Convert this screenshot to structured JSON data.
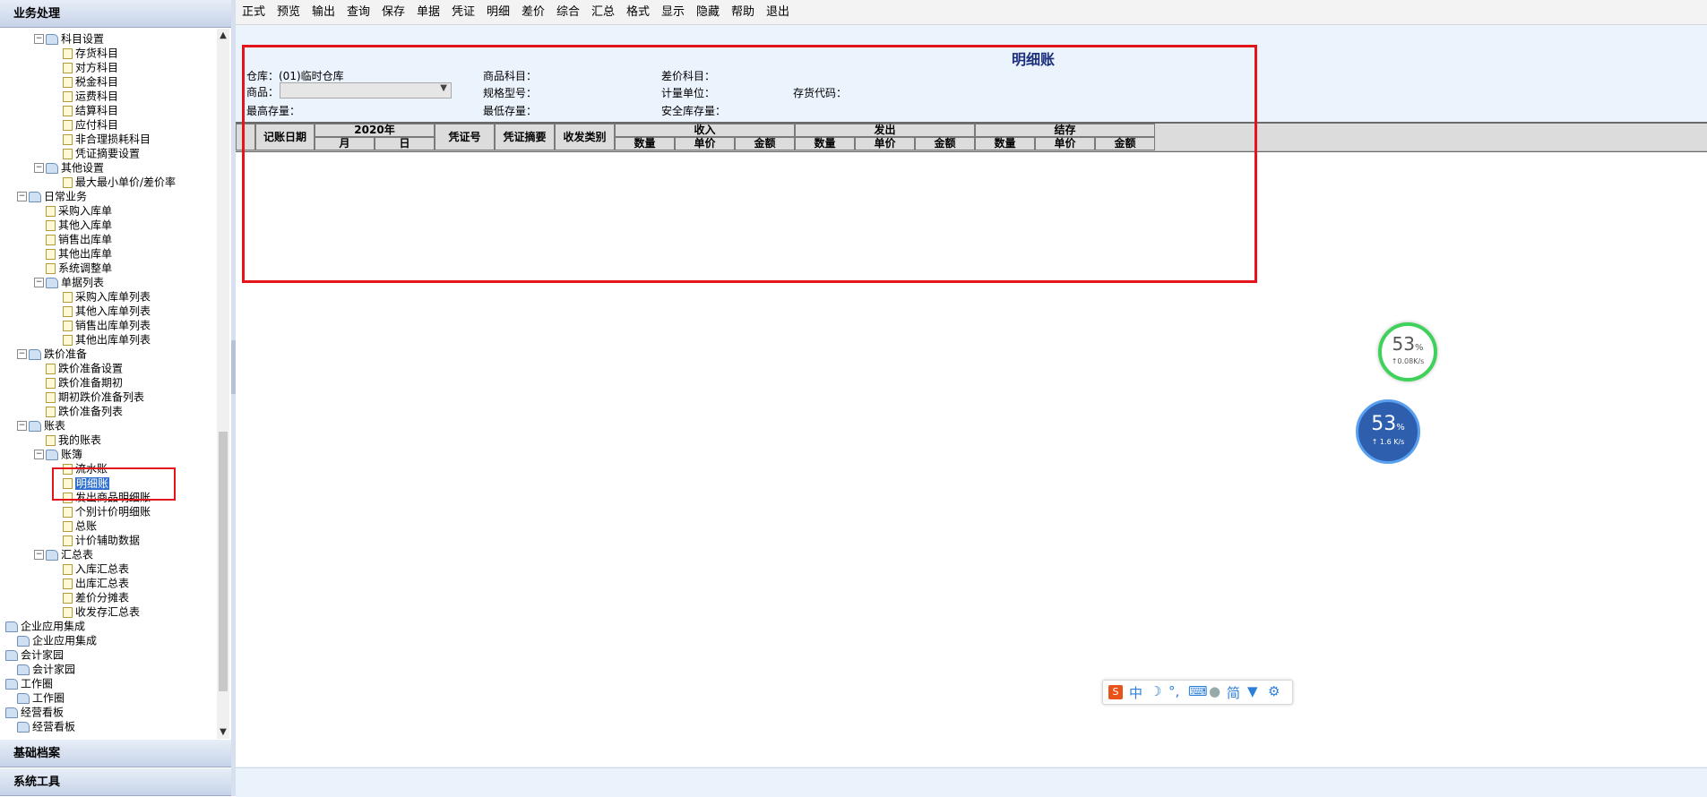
{
  "left_panel": {
    "header": "业务处理",
    "footer_items": [
      "基础档案",
      "系统工具"
    ],
    "tree": [
      {
        "label": "科目设置",
        "type": "folder",
        "level": 2,
        "toggle": "−"
      },
      {
        "label": "存货科目",
        "type": "doc",
        "level": 3
      },
      {
        "label": "对方科目",
        "type": "doc",
        "level": 3
      },
      {
        "label": "税金科目",
        "type": "doc",
        "level": 3
      },
      {
        "label": "运费科目",
        "type": "doc",
        "level": 3
      },
      {
        "label": "结算科目",
        "type": "doc",
        "level": 3
      },
      {
        "label": "应付科目",
        "type": "doc",
        "level": 3
      },
      {
        "label": "非合理损耗科目",
        "type": "doc",
        "level": 3
      },
      {
        "label": "凭证摘要设置",
        "type": "doc",
        "level": 3
      },
      {
        "label": "其他设置",
        "type": "folder",
        "level": 2,
        "toggle": "−"
      },
      {
        "label": "最大最小单价/差价率",
        "type": "doc",
        "level": 3
      },
      {
        "label": "日常业务",
        "type": "folder",
        "level": 1,
        "toggle": "−"
      },
      {
        "label": "采购入库单",
        "type": "doc",
        "level": 2
      },
      {
        "label": "其他入库单",
        "type": "doc",
        "level": 2
      },
      {
        "label": "销售出库单",
        "type": "doc",
        "level": 2
      },
      {
        "label": "其他出库单",
        "type": "doc",
        "level": 2
      },
      {
        "label": "系统调整单",
        "type": "doc",
        "level": 2
      },
      {
        "label": "单据列表",
        "type": "folder",
        "level": 2,
        "toggle": "−"
      },
      {
        "label": "采购入库单列表",
        "type": "doc",
        "level": 3
      },
      {
        "label": "其他入库单列表",
        "type": "doc",
        "level": 3
      },
      {
        "label": "销售出库单列表",
        "type": "doc",
        "level": 3
      },
      {
        "label": "其他出库单列表",
        "type": "doc",
        "level": 3
      },
      {
        "label": "跌价准备",
        "type": "folder",
        "level": 1,
        "toggle": "−"
      },
      {
        "label": "跌价准备设置",
        "type": "doc",
        "level": 2
      },
      {
        "label": "跌价准备期初",
        "type": "doc",
        "level": 2
      },
      {
        "label": "期初跌价准备列表",
        "type": "doc",
        "level": 2
      },
      {
        "label": "跌价准备列表",
        "type": "doc",
        "level": 2
      },
      {
        "label": "账表",
        "type": "folder",
        "level": 1,
        "toggle": "−"
      },
      {
        "label": "我的账表",
        "type": "doc",
        "level": 2
      },
      {
        "label": "账簿",
        "type": "folder",
        "level": 2,
        "toggle": "−"
      },
      {
        "label": "流水账",
        "type": "doc",
        "level": 3
      },
      {
        "label": "明细账",
        "type": "doc",
        "level": 3,
        "selected": true
      },
      {
        "label": "发出商品明细账",
        "type": "doc",
        "level": 3
      },
      {
        "label": "个别计价明细账",
        "type": "doc",
        "level": 3
      },
      {
        "label": "总账",
        "type": "doc",
        "level": 3
      },
      {
        "label": "计价辅助数据",
        "type": "doc",
        "level": 3
      },
      {
        "label": "汇总表",
        "type": "folder",
        "level": 2,
        "toggle": "−"
      },
      {
        "label": "入库汇总表",
        "type": "doc",
        "level": 3
      },
      {
        "label": "出库汇总表",
        "type": "doc",
        "level": 3
      },
      {
        "label": "差价分摊表",
        "type": "doc",
        "level": 3
      },
      {
        "label": "收发存汇总表",
        "type": "doc",
        "level": 3
      },
      {
        "label": "企业应用集成",
        "type": "folder",
        "level": 0
      },
      {
        "label": "企业应用集成",
        "type": "folder",
        "level": 1
      },
      {
        "label": "会计家园",
        "type": "folder",
        "level": 0
      },
      {
        "label": "会计家园",
        "type": "folder",
        "level": 1
      },
      {
        "label": "工作圈",
        "type": "folder",
        "level": 0
      },
      {
        "label": "工作圈",
        "type": "folder",
        "level": 1
      },
      {
        "label": "经营看板",
        "type": "folder",
        "level": 0
      },
      {
        "label": "经营看板",
        "type": "folder",
        "level": 1
      }
    ]
  },
  "toolbar": [
    "正式",
    "预览",
    "输出",
    "查询",
    "保存",
    "单据",
    "凭证",
    "明细",
    "差价",
    "综合",
    "汇总",
    "格式",
    "显示",
    "隐藏",
    "帮助",
    "退出"
  ],
  "report": {
    "title": "明细账",
    "warehouse": "仓库：(01)临时仓库",
    "goods_label": "商品：",
    "goods_value": "",
    "max_stock": "最高存量：",
    "goods_subject": "商品科目：",
    "spec": "规格型号：",
    "min_stock": "最低存量：",
    "diff_subject": "差价科目：",
    "unit": "计量单位：",
    "safe_stock": "安全库存量：",
    "stock_code": "存货代码："
  },
  "ledger_header": {
    "date": "记账日期",
    "year": "2020年",
    "month": "月",
    "day": "日",
    "voucher_no": "凭证号",
    "voucher_summary": "凭证摘要",
    "category": "收发类别",
    "groups": [
      "收入",
      "发出",
      "结存"
    ],
    "sub": [
      "数量",
      "单价",
      "金额"
    ]
  },
  "widgets": {
    "speed1": {
      "percent": "53",
      "unit": "%",
      "rate": "↑0.08K/s"
    },
    "speed2": {
      "percent": "53",
      "unit": "%",
      "rate": "↑ 1.6 K/s"
    },
    "ime": {
      "mode": "中",
      "simplified": "简"
    }
  }
}
